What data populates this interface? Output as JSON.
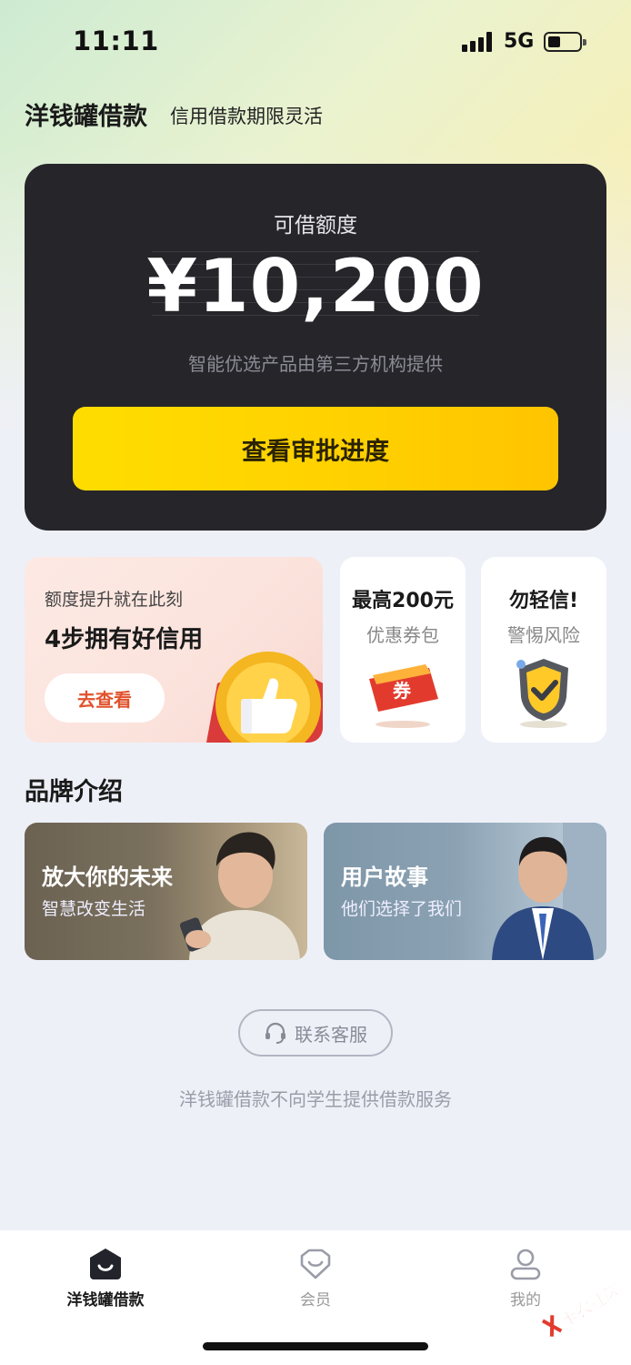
{
  "status_bar": {
    "time": "11:11",
    "network": "5G"
  },
  "header": {
    "title": "洋钱罐借款",
    "subtitle": "信用借款期限灵活"
  },
  "credit_card": {
    "label": "可借额度",
    "amount": "¥10,200",
    "note": "智能优选产品由第三方机构提供",
    "cta_label": "查看审批进度"
  },
  "promo_big": {
    "line1": "额度提升就在此刻",
    "line2": "4步拥有好信用",
    "button_label": "去查看"
  },
  "promo_coupon": {
    "title": "最高200元",
    "subtitle": "优惠券包",
    "icon_text": "券"
  },
  "promo_risk": {
    "title": "勿轻信!",
    "subtitle": "警惕风险"
  },
  "brand_section": {
    "title": "品牌介绍",
    "cards": [
      {
        "title": "放大你的未来",
        "subtitle": "智慧改变生活"
      },
      {
        "title": "用户故事",
        "subtitle": "他们选择了我们"
      }
    ]
  },
  "contact_label": "联系客服",
  "disclaimer": "洋钱罐借款不向学生提供借款服务",
  "tabs": [
    {
      "label": "洋钱罐借款",
      "icon": "home-icon",
      "active": true
    },
    {
      "label": "会员",
      "icon": "member-icon",
      "active": false
    },
    {
      "label": "我的",
      "icon": "profile-icon",
      "active": false
    }
  ],
  "watermark": "卡农社区",
  "colors": {
    "accent": "#ffd000",
    "card_bg": "#25252a",
    "cta_text": "#e0522c"
  }
}
